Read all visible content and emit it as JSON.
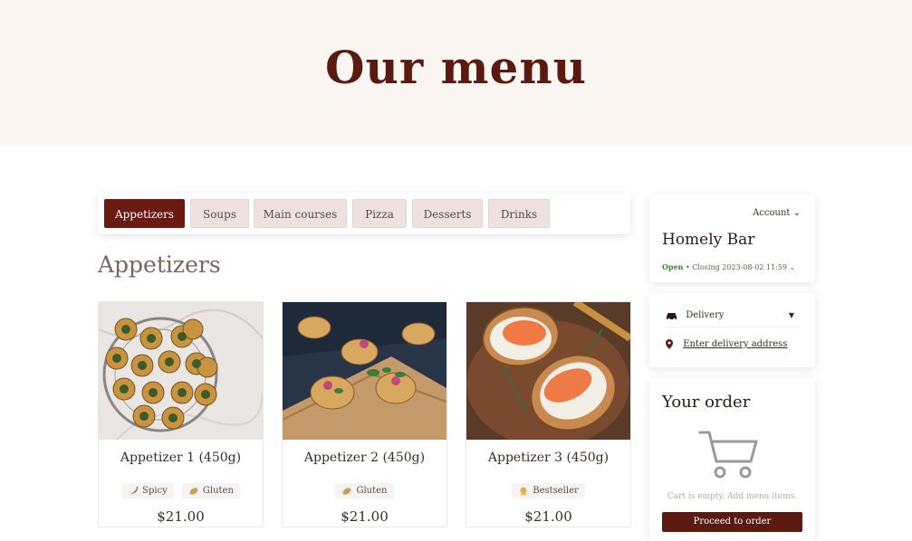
{
  "hero": {
    "title": "Our menu"
  },
  "tabs": [
    {
      "label": "Appetizers",
      "active": true
    },
    {
      "label": "Soups",
      "active": false
    },
    {
      "label": "Main courses",
      "active": false
    },
    {
      "label": "Pizza",
      "active": false
    },
    {
      "label": "Desserts",
      "active": false
    },
    {
      "label": "Drinks",
      "active": false
    }
  ],
  "section": {
    "title": "Appetizers"
  },
  "items": [
    {
      "name": "Appetizer 1 (450g)",
      "price": "$21.00",
      "tags": [
        {
          "label": "Spicy",
          "icon": "chili-icon"
        },
        {
          "label": "Gluten",
          "icon": "wheat-icon"
        }
      ]
    },
    {
      "name": "Appetizer 2 (450g)",
      "price": "$21.00",
      "tags": [
        {
          "label": "Gluten",
          "icon": "wheat-icon"
        }
      ]
    },
    {
      "name": "Appetizer 3 (450g)",
      "price": "$21.00",
      "tags": [
        {
          "label": "Bestseller",
          "icon": "award-icon"
        }
      ]
    }
  ],
  "restaurant": {
    "account_label": "Account",
    "name": "Homely Bar",
    "status_open": "Open",
    "status_detail": "• Closing 2023-08-02 11:59"
  },
  "delivery": {
    "mode": "Delivery",
    "address_link": "Enter delivery address"
  },
  "order": {
    "title": "Your order",
    "empty_text": "Cart is empty. Add menu items.",
    "checkout_label": "Proceed to order"
  },
  "colors": {
    "brand": "#5a1a10",
    "hero_bg": "#fcf6f3",
    "tab_bg": "#ede2e0",
    "open_green": "#2e8b2e"
  }
}
